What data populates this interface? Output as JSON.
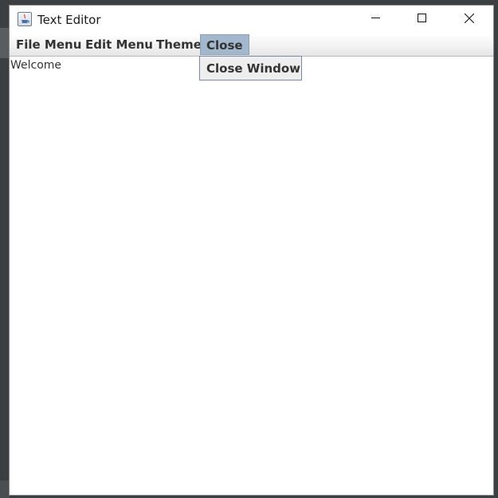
{
  "window": {
    "title": "Text Editor",
    "controls": {
      "minimize_icon": "minimize-icon",
      "maximize_icon": "maximize-icon",
      "close_icon": "close-icon"
    }
  },
  "menubar": {
    "items": [
      {
        "label": "File Menu"
      },
      {
        "label": "Edit Menu"
      },
      {
        "label": "Theme"
      },
      {
        "label": "Close",
        "active": true
      }
    ]
  },
  "dropdown": {
    "items": [
      {
        "label": "Close Window"
      }
    ]
  },
  "editor": {
    "content": "Welcome"
  },
  "colors": {
    "menu_highlight": "#a3b8cc",
    "dropdown_background": "#eeeeee",
    "desktop_background": "#3c3f41"
  }
}
